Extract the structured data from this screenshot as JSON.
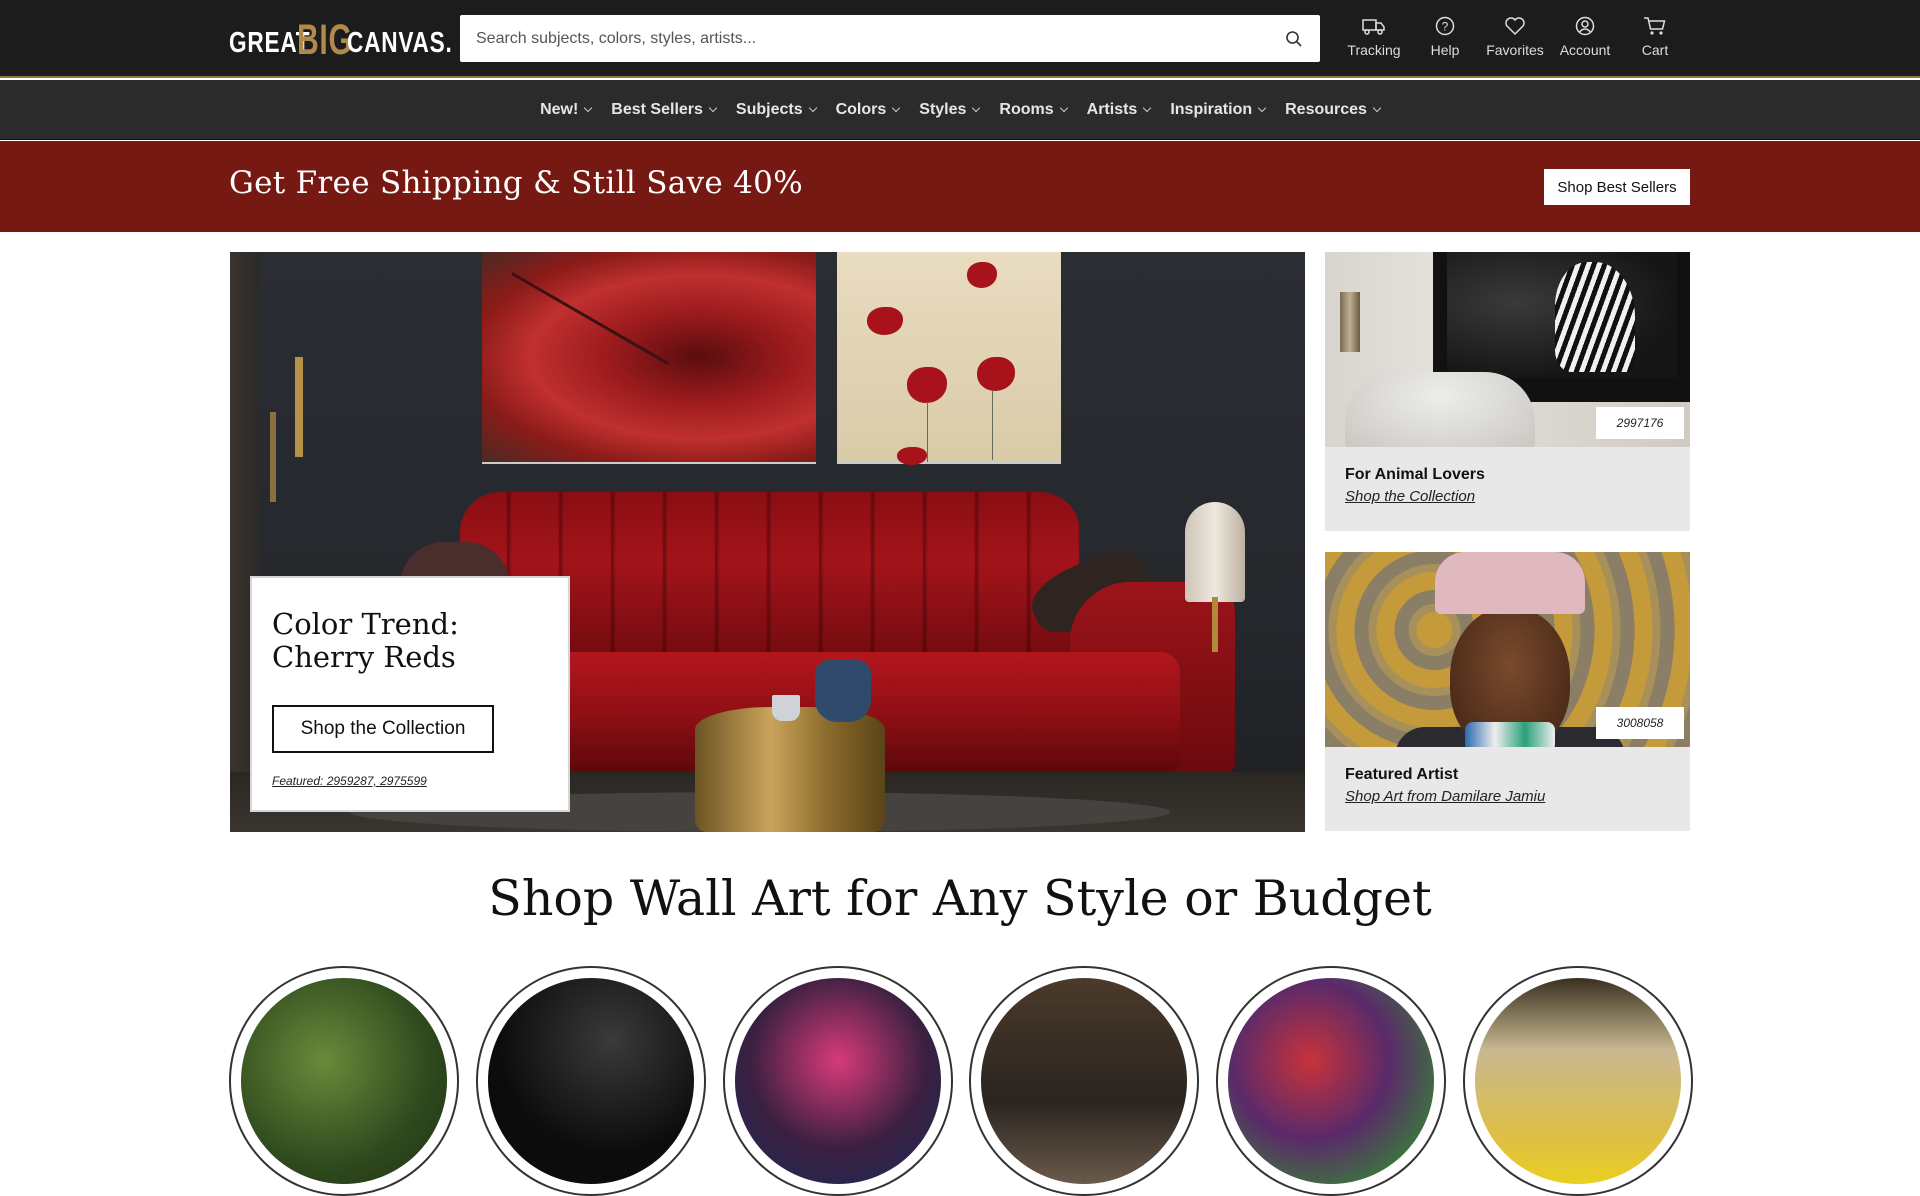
{
  "header": {
    "logo": {
      "part1": "GREAT",
      "part2": "BIG",
      "part3": "CANVAS."
    },
    "search_placeholder": "Search subjects, colors, styles, artists...",
    "utilities": [
      {
        "label": "Tracking",
        "icon": "truck-icon"
      },
      {
        "label": "Help",
        "icon": "help-icon"
      },
      {
        "label": "Favorites",
        "icon": "heart-icon"
      },
      {
        "label": "Account",
        "icon": "user-icon"
      },
      {
        "label": "Cart",
        "icon": "cart-icon"
      }
    ]
  },
  "nav": {
    "items": [
      "New!",
      "Best Sellers",
      "Subjects",
      "Colors",
      "Styles",
      "Rooms",
      "Artists",
      "Inspiration",
      "Resources"
    ]
  },
  "promo": {
    "text": "Get Free Shipping & Still Save 40%",
    "button": "Shop Best Sellers",
    "background": "#761913"
  },
  "hero": {
    "title": "Color Trend: Cherry Reds",
    "button": "Shop the Collection",
    "featured": "Featured: 2959287, 2975599"
  },
  "side_promos": [
    {
      "tag": "2997176",
      "title": "For Animal Lovers",
      "link": "Shop the Collection"
    },
    {
      "tag": "3008058",
      "title": "Featured Artist",
      "link": "Shop Art from Damilare Jamiu"
    }
  ],
  "section": {
    "title": "Shop Wall Art for Any Style or Budget"
  },
  "colors": {
    "topbar": "#1c1c1c",
    "navbar": "#2b2b2b",
    "accent_gold": "#b08a4a"
  }
}
